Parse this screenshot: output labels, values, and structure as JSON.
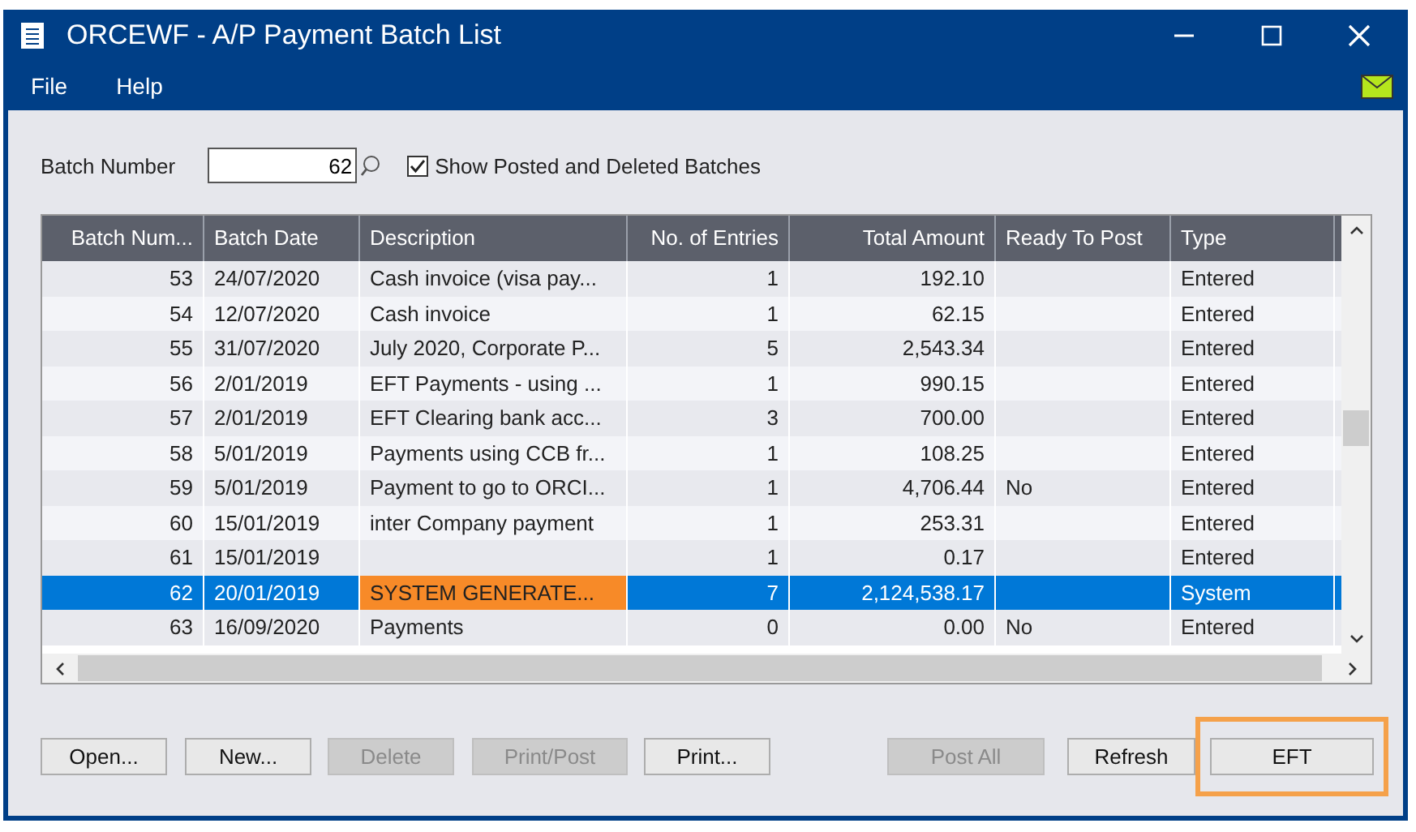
{
  "window": {
    "title": "ORCEWF - A/P Payment Batch List"
  },
  "menu": [
    "File",
    "Help"
  ],
  "filter": {
    "label": "Batch Number",
    "value": "62",
    "show_posted": {
      "label": "Show Posted and Deleted Batches",
      "checked": true
    }
  },
  "table": {
    "columns": [
      {
        "label": "Batch Num..."
      },
      {
        "label": "Batch Date"
      },
      {
        "label": "Description"
      },
      {
        "label": "No. of Entries"
      },
      {
        "label": "Total Amount"
      },
      {
        "label": "Ready To Post"
      },
      {
        "label": "Type"
      }
    ],
    "rows": [
      {
        "selected": false,
        "flagged": false,
        "cells": [
          "53",
          "24/07/2020",
          "Cash invoice (visa pay...",
          "1",
          "192.10",
          "",
          "Entered"
        ]
      },
      {
        "selected": false,
        "flagged": false,
        "cells": [
          "54",
          "12/07/2020",
          "Cash invoice",
          "1",
          "62.15",
          "",
          "Entered"
        ]
      },
      {
        "selected": false,
        "flagged": false,
        "cells": [
          "55",
          "31/07/2020",
          "July 2020, Corporate P...",
          "5",
          "2,543.34",
          "",
          "Entered"
        ]
      },
      {
        "selected": false,
        "flagged": false,
        "cells": [
          "56",
          "2/01/2019",
          "EFT Payments - using ...",
          "1",
          "990.15",
          "",
          "Entered"
        ]
      },
      {
        "selected": false,
        "flagged": false,
        "cells": [
          "57",
          "2/01/2019",
          "EFT Clearing bank acc...",
          "3",
          "700.00",
          "",
          "Entered"
        ]
      },
      {
        "selected": false,
        "flagged": false,
        "cells": [
          "58",
          "5/01/2019",
          "Payments using CCB fr...",
          "1",
          "108.25",
          "",
          "Entered"
        ]
      },
      {
        "selected": false,
        "flagged": false,
        "cells": [
          "59",
          "5/01/2019",
          "Payment to go to ORCI...",
          "1",
          "4,706.44",
          "No",
          "Entered"
        ]
      },
      {
        "selected": false,
        "flagged": false,
        "cells": [
          "60",
          "15/01/2019",
          "inter Company payment",
          "1",
          "253.31",
          "",
          "Entered"
        ]
      },
      {
        "selected": false,
        "flagged": false,
        "cells": [
          "61",
          "15/01/2019",
          "",
          "1",
          "0.17",
          "",
          "Entered"
        ]
      },
      {
        "selected": true,
        "flagged": true,
        "cells": [
          "62",
          "20/01/2019",
          "SYSTEM GENERATE...",
          "7",
          "2,124,538.17",
          "",
          "System"
        ]
      },
      {
        "selected": false,
        "flagged": false,
        "cells": [
          "63",
          "16/09/2020",
          "Payments",
          "0",
          "0.00",
          "No",
          "Entered"
        ]
      }
    ]
  },
  "buttons": [
    {
      "label": "Open...",
      "disabled": false,
      "highlighted": false
    },
    {
      "label": "New...",
      "disabled": false,
      "highlighted": false
    },
    {
      "label": "Delete",
      "disabled": true,
      "highlighted": false
    },
    {
      "label": "Print/Post",
      "disabled": true,
      "highlighted": false
    },
    {
      "label": "Print...",
      "disabled": false,
      "highlighted": false
    },
    {
      "label": "Post All",
      "disabled": true,
      "highlighted": false
    },
    {
      "label": "Refresh",
      "disabled": false,
      "highlighted": false
    },
    {
      "label": "EFT",
      "disabled": false,
      "highlighted": true
    }
  ]
}
